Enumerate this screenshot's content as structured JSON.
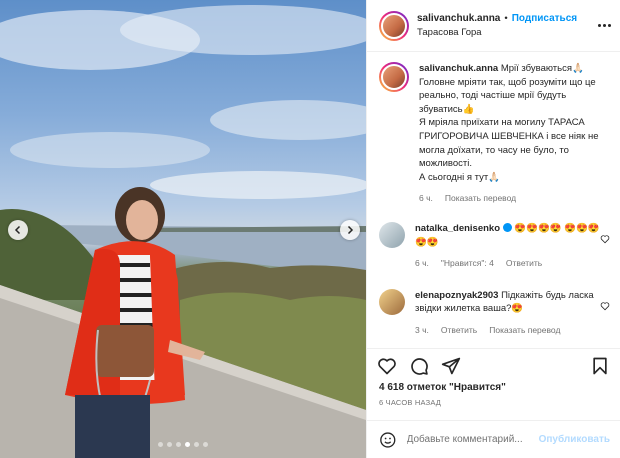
{
  "header": {
    "username": "salivanchuk.anna",
    "separator": "•",
    "follow_label": "Подписаться",
    "location": "Тарасова Гора"
  },
  "caption": {
    "username": "salivanchuk.anna",
    "text": "Мрії збуваються🙏🏻 Головне мріяти так, щоб розуміти що це реально, тоді частіше мрії будуть збуватись👍",
    "text2": "Я мріяла приїхати на могилу ТАРАСА ГРИГОРОВИЧА ШЕВЧЕНКА і все ніяк не могла доїхати, то часу не було, то можливості.",
    "text3": "А сьогодні я тут🙏🏻",
    "age": "6 ч.",
    "translate": "Показать перевод"
  },
  "comments": [
    {
      "username": "natalka_denisenko",
      "text": "😍😍😍😍 😍😍😍😍😍",
      "age": "6 ч.",
      "likes": "\"Нравится\": 4",
      "reply": "Ответить"
    },
    {
      "username": "elenapoznyak2903",
      "text": "Підкажіть будь ласка звідки жилетка ваша?😍",
      "age": "3 ч.",
      "reply": "Ответить",
      "translate": "Показать перевод"
    }
  ],
  "likes_text": "4 618 отметок \"Нравится\"",
  "time_ago": "6 ЧАСОВ НАЗАД",
  "add_comment": {
    "placeholder": "Добавьте комментарий...",
    "post_label": "Опубликовать"
  },
  "carousel": {
    "total": 6,
    "active_index": 3
  },
  "colors": {
    "accent": "#0095f6",
    "text": "#262626",
    "muted": "#737373",
    "post_disabled": "#b3dbff"
  },
  "icons": [
    "chevron-left-icon",
    "chevron-right-icon",
    "more-icon",
    "heart-icon",
    "comment-icon",
    "share-icon",
    "bookmark-icon",
    "smile-icon"
  ]
}
